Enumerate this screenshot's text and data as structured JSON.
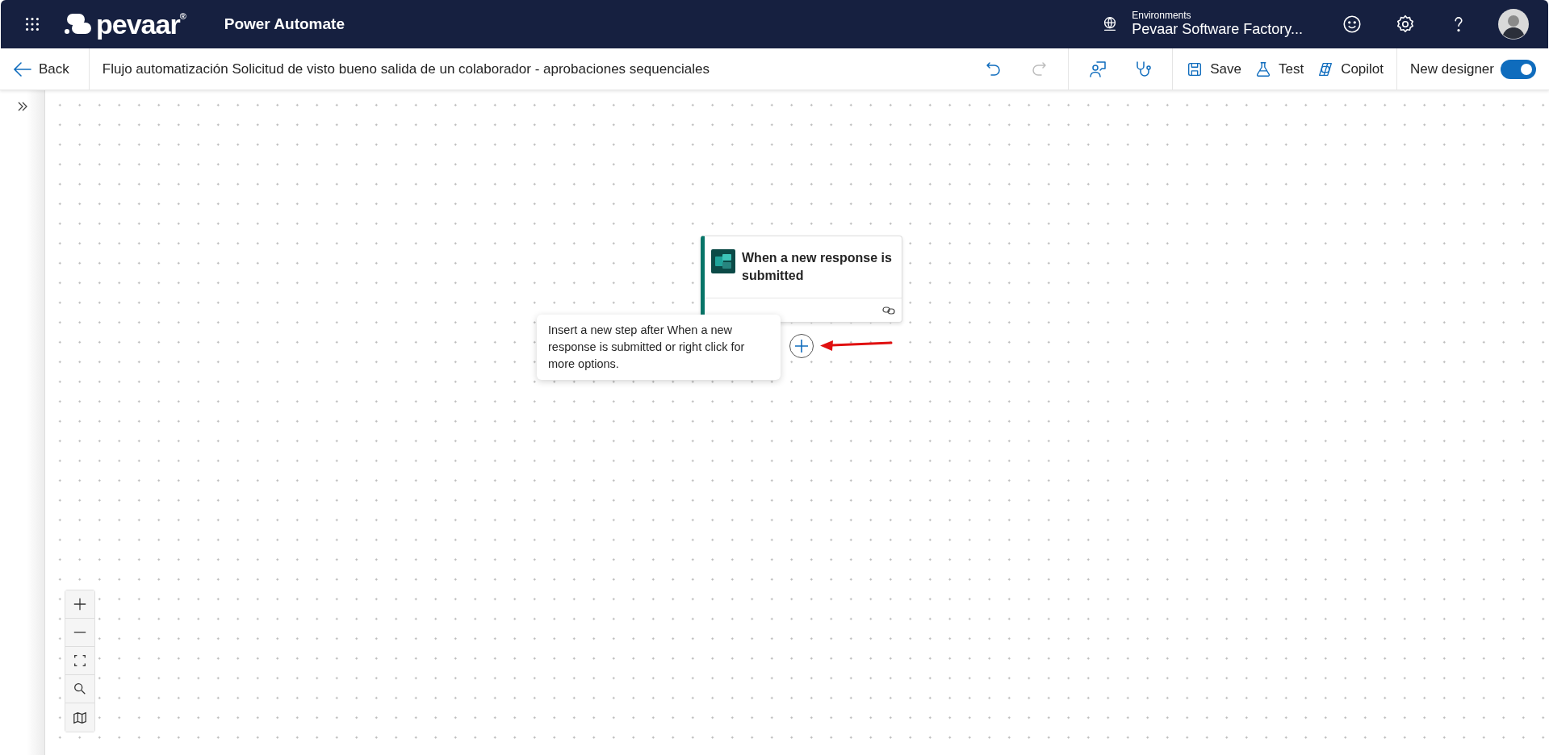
{
  "app_bar": {
    "brand": "pevaar$^{®}$",
    "app_name": "Power Automate",
    "environment_label": "Environments",
    "environment_name": "Pevaar Software Factory..."
  },
  "toolbar": {
    "back": "Back",
    "flow_title": "Flujo automatización Solicitud de visto bueno salida de un colaborador - aprobaciones sequenciales",
    "history": [
      {
        "kind": "undo",
        "disabled": false
      },
      {
        "kind": "redo",
        "disabled": true
      }
    ],
    "tools": [
      {
        "kind": "feedback"
      },
      {
        "kind": "checker"
      }
    ],
    "actions": [
      {
        "kind": "save",
        "label": "Save"
      },
      {
        "kind": "test",
        "label": "Test"
      },
      {
        "kind": "copilot",
        "label": "Copilot"
      }
    ],
    "new_designer": {
      "label": "New designer",
      "on": true
    }
  },
  "canvas": {
    "node": {
      "title": "When a new response is submitted"
    },
    "tooltip": "Insert a new step after When a new response is submitted or right click for more options."
  }
}
